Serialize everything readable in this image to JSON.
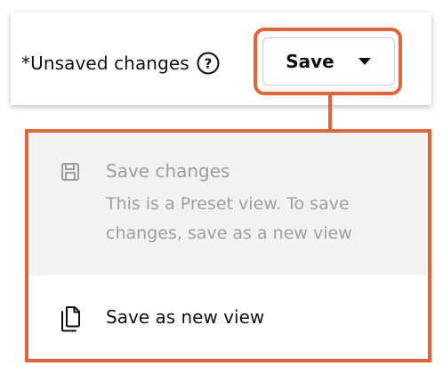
{
  "header": {
    "unsaved_text": "*Unsaved changes",
    "help_icon": "question-circle-icon",
    "save_label": "Save",
    "caret_icon": "caret-down-icon"
  },
  "menu": {
    "items": [
      {
        "icon": "floppy-disk-icon",
        "label": "Save changes",
        "description": "This is a Preset view. To save changes, save as a new view",
        "disabled": true
      },
      {
        "icon": "copy-icon",
        "label": "Save as new view",
        "disabled": false
      }
    ]
  },
  "colors": {
    "highlight": "#e0663a",
    "disabled_text": "#9e9e9e",
    "disabled_bg": "#f2f2f2",
    "text": "#111111"
  }
}
